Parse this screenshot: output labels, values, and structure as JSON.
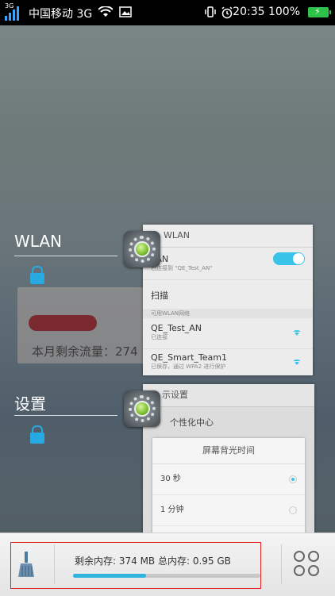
{
  "status_bar": {
    "network_type": "3G",
    "carrier": "中国移动 3G",
    "time": "20:35",
    "battery_percent": "100%"
  },
  "recent_apps": [
    {
      "title": "WLAN",
      "card": {
        "header": "WLAN",
        "toggle_title": "LAN",
        "toggle_subtitle": "已连接到 \"QE_Test_AN\"",
        "toggle_on": true,
        "scan_label": "扫描",
        "section_label": "可用WLAN网络",
        "networks": [
          {
            "name": "QE_Test_AN",
            "status": "已连接"
          },
          {
            "name": "QE_Smart_Team1",
            "status": "已保存，通过 WPA2 进行保护"
          }
        ]
      }
    },
    {
      "title": "设置",
      "card": {
        "header": "示设置",
        "item": "个性化中心",
        "dialog_title": "屏幕背光时间",
        "options": [
          {
            "label": "30 秒",
            "selected": true
          },
          {
            "label": "1 分钟",
            "selected": false
          }
        ]
      }
    }
  ],
  "background_card": {
    "text": "本月剩余流量：274"
  },
  "bottom_bar": {
    "memory_text": "剩余内存: 374 MB   总内存: 0.95 GB",
    "memory_used_fraction": 0.39
  }
}
